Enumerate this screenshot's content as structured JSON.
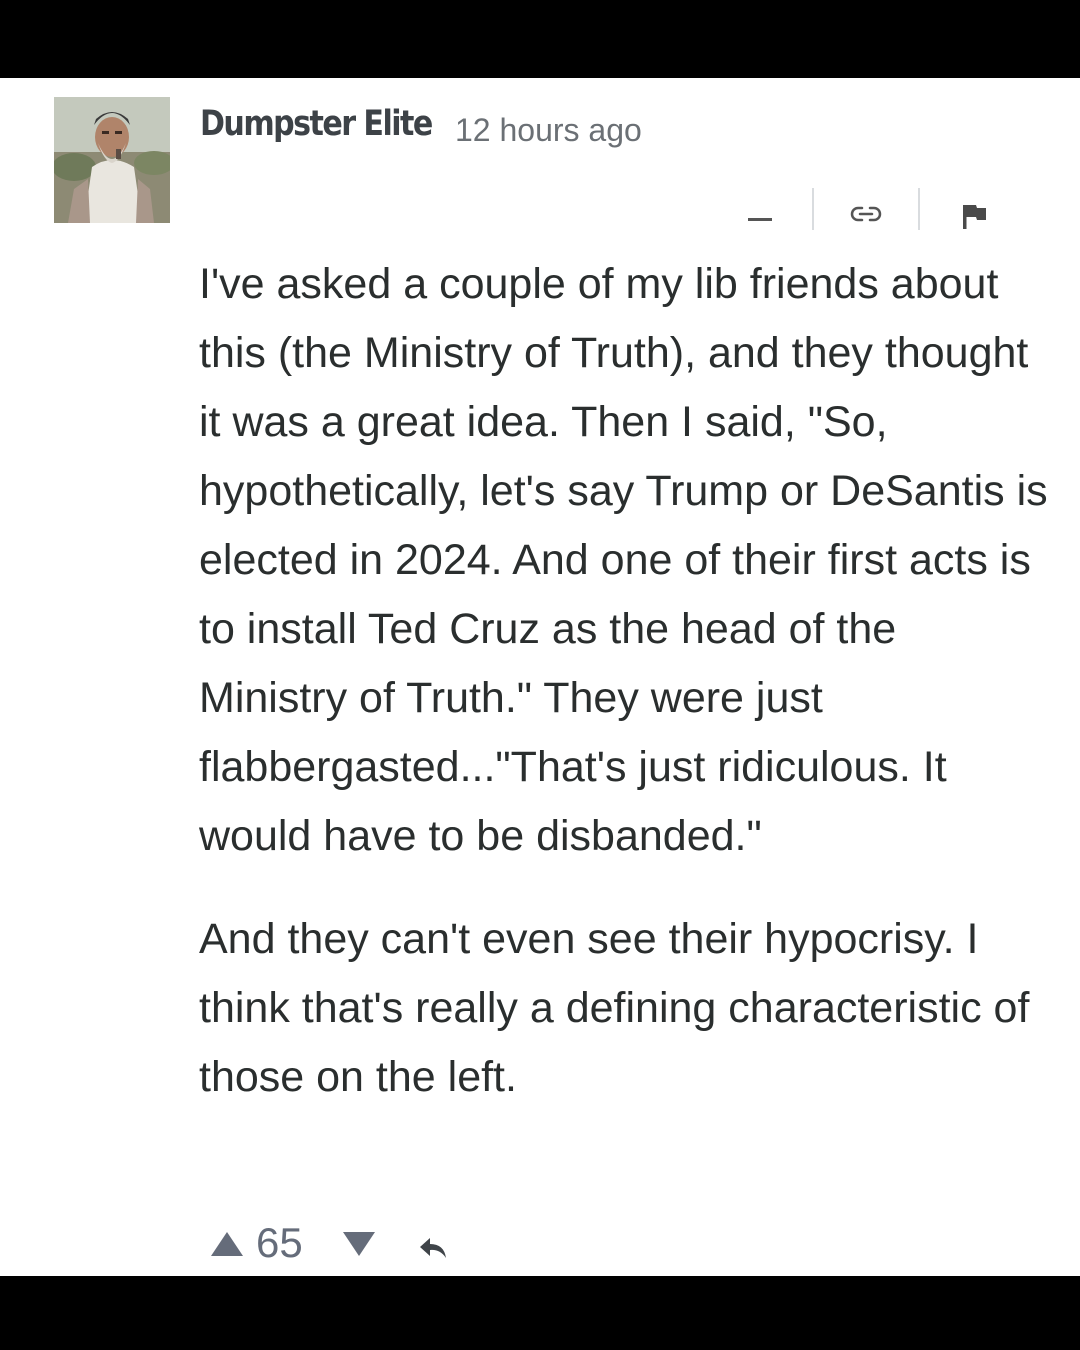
{
  "comment": {
    "author": "Dumpster Elite",
    "timestamp": "12 hours ago",
    "paragraphs": [
      "I've asked a couple of my lib friends about this (the Ministry of Truth), and they thought it was a great idea. Then I said, \"So, hypothetically, let's say Trump or DeSantis is elected in 2024. And one of their first acts is to install Ted Cruz as the head of the Ministry of Truth.\" They were just flabbergasted...\"That's just ridiculous. It would have to be disbanded.\"",
      "And they can't even see their hypocrisy. I think that's really a defining characteristic of those on the left."
    ],
    "votes": {
      "score": "65"
    }
  },
  "icons": {
    "collapse": "minus-icon",
    "permalink": "link-icon",
    "flag": "flag-icon",
    "upvote": "triangle-up-icon",
    "downvote": "triangle-down-icon",
    "reply": "reply-arrow-icon"
  },
  "colors": {
    "background": "#ffffff",
    "frame": "#000000",
    "author": "#3d4247",
    "meta": "#6b7075",
    "body_text": "#2a2e2e",
    "vote": "#656c7a"
  }
}
